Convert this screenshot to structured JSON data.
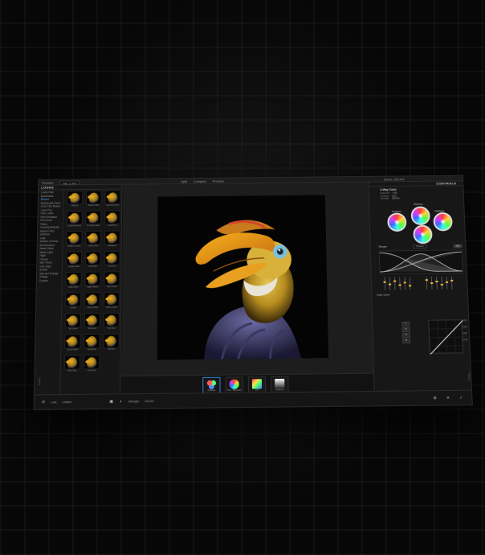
{
  "colors": {
    "accent": "#2b7fd8",
    "active_category": "#4aa3ff",
    "panel": "#171717"
  },
  "topbar": {
    "preview_label": "Preview",
    "preset_select": "No. 1 XX",
    "view_modes": [
      "Split",
      "Compare",
      "Preview"
    ],
    "zoom_label": "Zoom: 100.0%"
  },
  "looks": {
    "title": "LOOKS",
    "categories": [
      "Looks Filter",
      "Bookmarks",
      "Recent",
      "Blockbuster Wars",
      "Color Film Blocks",
      "Color Pop",
      "Cine Looks",
      "Film Emulation",
      "Film Grain",
      "Filters",
      "Grading Defaults",
      "Modern Film",
      "Glamour",
      "Indie",
      "Modern Cinema",
      "Monochrome",
      "Music Video",
      "Mixed Light",
      "Night",
      "Portrait",
      "Skin Tones",
      "Cine Style",
      "Sunset",
      "Teal and Orange",
      "Vintage",
      "Custom"
    ],
    "active_category": 2,
    "thumbs": [
      "Highcut",
      "Gibson Blue",
      "Quantum Noir",
      "Cobalt Dreams",
      "Frosted Glass",
      "Gold Dust",
      "Golden Crown",
      "Grainy Film",
      "Hawaiian",
      "Jungle Heat",
      "Lavender",
      "Low Sun",
      "Matte Blue",
      "Night Watch",
      "Neon Flare",
      "Outlier",
      "Velvet Gold",
      "Warm Glow",
      "Tan Lines",
      "Teal Hunt",
      "Pop Sun",
      "Sunset Blvd",
      "Overdrive",
      "Refresh",
      "Retro Mix",
      "Volt Cast"
    ]
  },
  "filmstrip": [
    {
      "label": "Colorista"
    },
    {
      "label": "Hue / Saturation"
    },
    {
      "label": "LUT"
    },
    {
      "label": "Gradients"
    }
  ],
  "controls": {
    "title": "CONTROLS",
    "section_title": "4-Way Color",
    "params": [
      {
        "k": "Exposure",
        "v": "0.00"
      },
      {
        "k": "Contrast",
        "v": "0.00"
      },
      {
        "k": "Strength",
        "v": "100.0%"
      }
    ],
    "wheels": {
      "midtones": "Midtones",
      "shadows": "Shadows",
      "highlights": "Highlights",
      "master": "Master"
    },
    "ranges": {
      "title": "Ranges",
      "btn_preview": "Preview",
      "btn_off": "Off"
    },
    "curve": {
      "title": "Color Curve",
      "channels": [
        "Y",
        "R",
        "G",
        "B"
      ],
      "values": [
        "0.000",
        "0.000",
        "0.000",
        "0.000"
      ]
    }
  },
  "sidelabels": {
    "left": "LOOKS",
    "right": "TOOLS"
  },
  "status": {
    "label": "Look:",
    "name": "Untitled",
    "strength_label": "Strength:",
    "strength_value": "100.0%"
  }
}
